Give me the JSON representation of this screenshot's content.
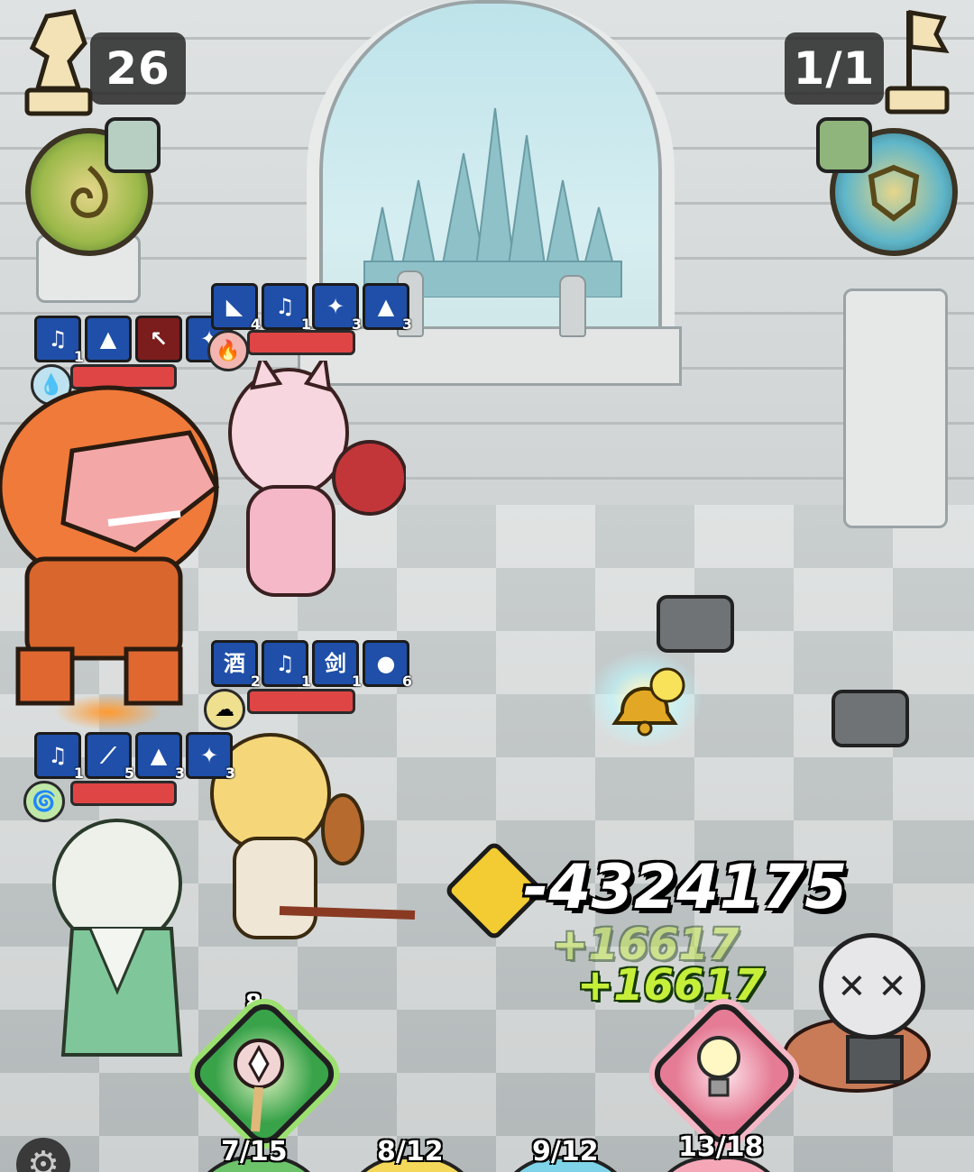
{
  "hud": {
    "turns_left": "26",
    "wave": "1/1"
  },
  "allies": [
    {
      "id": "shark",
      "skills": [
        {
          "icon": "♫",
          "count": "1"
        },
        {
          "icon": "▲",
          "count": ""
        },
        {
          "icon": "↖",
          "count": "",
          "red": true
        },
        {
          "icon": "✦",
          "count": "3"
        }
      ],
      "hp_fraction": 1.0
    },
    {
      "id": "fox-girl",
      "skills": [
        {
          "icon": "◣",
          "count": "4"
        },
        {
          "icon": "♫",
          "count": "1"
        },
        {
          "icon": "✦",
          "count": "3"
        },
        {
          "icon": "▲",
          "count": "3"
        }
      ],
      "hp_fraction": 1.0
    },
    {
      "id": "gourd-girl",
      "skills": [
        {
          "icon": "酒",
          "count": "2"
        },
        {
          "icon": "♫",
          "count": "1"
        },
        {
          "icon": "剑",
          "count": "1"
        },
        {
          "icon": "●",
          "count": "6"
        }
      ],
      "hp_fraction": 1.0
    },
    {
      "id": "elder",
      "skills": [
        {
          "icon": "♫",
          "count": "1"
        },
        {
          "icon": "⟋",
          "count": "5"
        },
        {
          "icon": "▲",
          "count": "3"
        },
        {
          "icon": "✦",
          "count": "3"
        }
      ],
      "hp_fraction": 1.0
    }
  ],
  "combat": {
    "damage": "-4324175",
    "heal_main": "+16617",
    "heal_ghost": "+16617"
  },
  "bottom": {
    "ability_count": "8",
    "counters": [
      "7/15",
      "8/12",
      "9/12",
      "13/18"
    ]
  },
  "colors": {
    "hp": "#e04545",
    "skill_blue": "#1f4fa8",
    "heal_green": "#c6ef3a",
    "ability_green": "#39a34a",
    "ability_pink": "#e57b95"
  }
}
